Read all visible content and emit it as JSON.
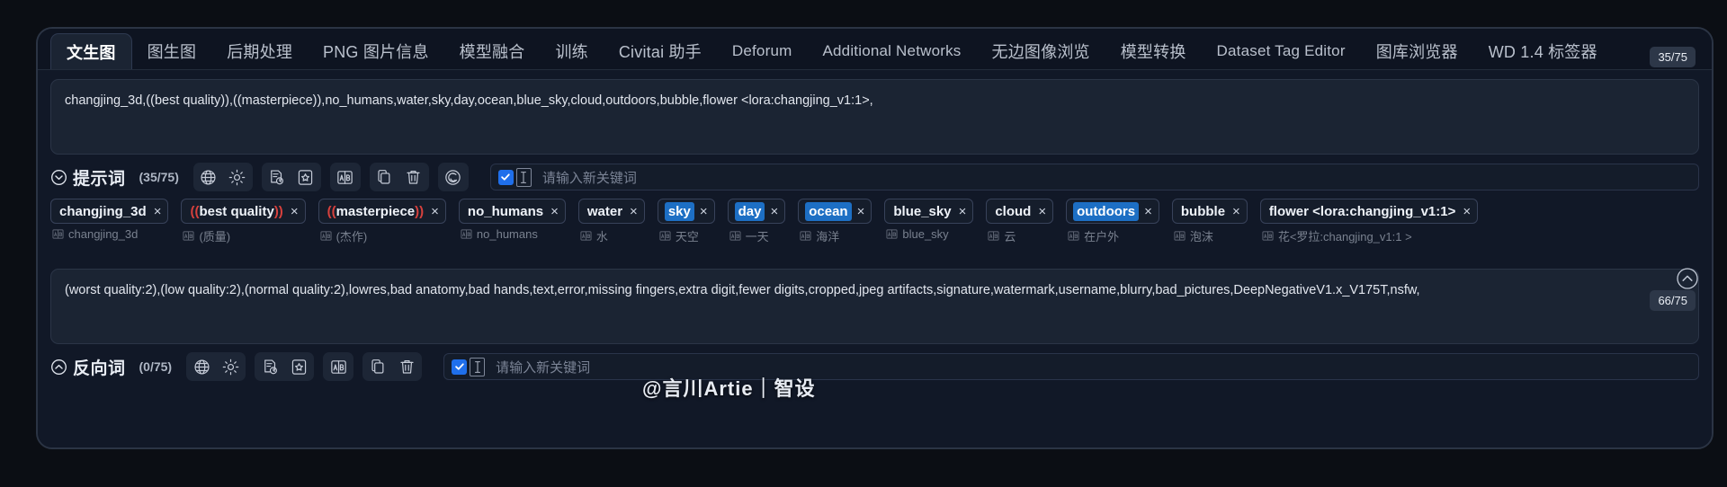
{
  "window": {
    "tabs": [
      {
        "label": "文生图",
        "active": true,
        "cjk": true
      },
      {
        "label": "图生图",
        "active": false,
        "cjk": true
      },
      {
        "label": "后期处理",
        "active": false,
        "cjk": true
      },
      {
        "label": "PNG 图片信息",
        "active": false,
        "cjk": true
      },
      {
        "label": "模型融合",
        "active": false,
        "cjk": true
      },
      {
        "label": "训练",
        "active": false,
        "cjk": true
      },
      {
        "label": "Civitai 助手",
        "active": false,
        "cjk": true
      },
      {
        "label": "Deforum",
        "active": false,
        "cjk": false
      },
      {
        "label": "Additional Networks",
        "active": false,
        "cjk": false
      },
      {
        "label": "无边图像浏览",
        "active": false,
        "cjk": true
      },
      {
        "label": "模型转换",
        "active": false,
        "cjk": true
      },
      {
        "label": "Dataset Tag Editor",
        "active": false,
        "cjk": false
      },
      {
        "label": "图库浏览器",
        "active": false,
        "cjk": true
      },
      {
        "label": "WD 1.4 标签器",
        "active": false,
        "cjk": true
      }
    ]
  },
  "positive": {
    "prompt_text": "changjing_3d,((best quality)),((masterpiece)),no_humans,water,sky,day,ocean,blue_sky,cloud,outdoors,bubble,flower <lora:changjing_v1:1>,",
    "section_title": "提示词",
    "token_count": "(35/75)",
    "badge": "35/75",
    "chevron_icon": "chevron-down-circle-icon",
    "toolbar": [
      {
        "name": "globe-icon",
        "group": 0
      },
      {
        "name": "gear-icon",
        "group": 0
      },
      {
        "name": "history-icon",
        "group": 1
      },
      {
        "name": "bookmark-star-icon",
        "group": 1
      },
      {
        "name": "translate-ab-icon",
        "group": 2
      },
      {
        "name": "copy-icon",
        "group": 3
      },
      {
        "name": "trash-icon",
        "group": 3
      },
      {
        "name": "spiral-icon",
        "group": 4
      }
    ],
    "keyword_placeholder": "请输入新关键词",
    "keyword_checked": true,
    "tags": [
      {
        "text": "changjing_3d",
        "translation": "changjing_3d",
        "highlight": false,
        "emphasis": false
      },
      {
        "text": "((best quality))",
        "translation": "(质量)",
        "highlight": false,
        "emphasis": true
      },
      {
        "text": "((masterpiece))",
        "translation": "(杰作)",
        "highlight": false,
        "emphasis": true
      },
      {
        "text": "no_humans",
        "translation": "no_humans",
        "highlight": false,
        "emphasis": false
      },
      {
        "text": "water",
        "translation": "水",
        "highlight": false,
        "emphasis": false
      },
      {
        "text": "sky",
        "translation": "天空",
        "highlight": true,
        "emphasis": false
      },
      {
        "text": "day",
        "translation": "一天",
        "highlight": true,
        "emphasis": false
      },
      {
        "text": "ocean",
        "translation": "海洋",
        "highlight": true,
        "emphasis": false
      },
      {
        "text": "blue_sky",
        "translation": "blue_sky",
        "highlight": false,
        "emphasis": false
      },
      {
        "text": "cloud",
        "translation": "云",
        "highlight": false,
        "emphasis": false
      },
      {
        "text": "outdoors",
        "translation": "在户外",
        "highlight": true,
        "emphasis": false
      },
      {
        "text": "bubble",
        "translation": "泡沫",
        "highlight": false,
        "emphasis": false
      },
      {
        "text": "flower <lora:changjing_v1:1>",
        "translation": "花<罗拉:changjing_v1:1 >",
        "highlight": false,
        "emphasis": false
      }
    ]
  },
  "negative": {
    "prompt_text": "(worst quality:2),(low quality:2),(normal quality:2),lowres,bad anatomy,bad hands,text,error,missing fingers,extra digit,fewer digits,cropped,jpeg artifacts,signature,watermark,username,blurry,bad_pictures,DeepNegativeV1.x_V175T,nsfw,",
    "section_title": "反向词",
    "token_count": "(0/75)",
    "badge": "66/75",
    "chevron_icon": "chevron-up-circle-icon",
    "toolbar": [
      {
        "name": "globe-icon",
        "group": 0
      },
      {
        "name": "gear-icon",
        "group": 0
      },
      {
        "name": "history-icon",
        "group": 1
      },
      {
        "name": "bookmark-star-icon",
        "group": 1
      },
      {
        "name": "translate-ab-icon",
        "group": 2
      },
      {
        "name": "copy-icon",
        "group": 3
      },
      {
        "name": "trash-icon",
        "group": 3
      }
    ],
    "keyword_placeholder": "请输入新关键词",
    "keyword_checked": true
  },
  "watermark": "@言川Artie｜智设",
  "colors": {
    "accent_blue": "#1f6feb",
    "tag_highlight": "#1d6fc4",
    "emphasis_red": "#d7413d",
    "panel_bg": "#111827",
    "field_bg": "#1b2433"
  }
}
